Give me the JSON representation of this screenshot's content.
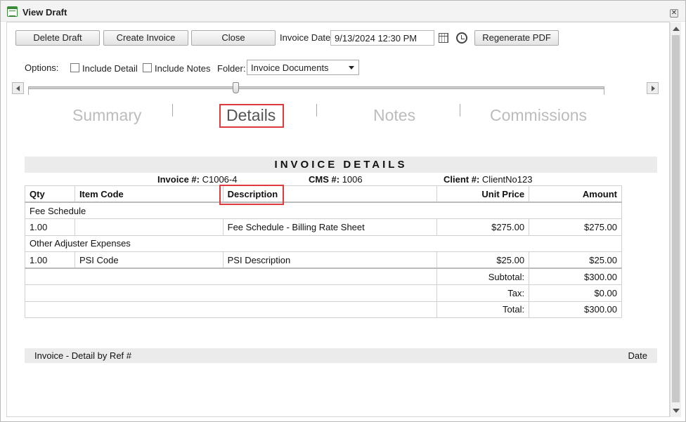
{
  "window": {
    "title": "View Draft"
  },
  "toolbar": {
    "delete_label": "Delete Draft",
    "create_label": "Create Invoice",
    "close_label": "Close",
    "invoice_date_label": "Invoice Date:",
    "invoice_date_value": "9/13/2024 12:30 PM",
    "regenerate_label": "Regenerate PDF"
  },
  "options": {
    "label": "Options:",
    "include_detail": "Include Detail",
    "include_notes": "Include Notes",
    "folder_label": "Folder:",
    "folder_value": "Invoice Documents"
  },
  "tabs": [
    "Summary",
    "Details",
    "Notes",
    "Commissions"
  ],
  "active_tab": "Details",
  "invoice": {
    "heading": "INVOICE DETAILS",
    "invoice_no_label": "Invoice #:",
    "invoice_no": "C1006-4",
    "cms_label": "CMS #:",
    "cms_no": "1006",
    "client_label": "Client #:",
    "client_no": "ClientNo123",
    "columns": {
      "qty": "Qty",
      "item_code": "Item Code",
      "description": "Description",
      "unit_price": "Unit Price",
      "amount": "Amount"
    },
    "groups": [
      {
        "name": "Fee Schedule",
        "rows": [
          {
            "qty": "1.00",
            "item_code": "",
            "description": "Fee Schedule - Billing Rate Sheet",
            "unit_price": "$275.00",
            "amount": "$275.00"
          }
        ]
      },
      {
        "name": "Other Adjuster Expenses",
        "rows": [
          {
            "qty": "1.00",
            "item_code": "PSI Code",
            "description": "PSI Description",
            "unit_price": "$25.00",
            "amount": "$25.00"
          }
        ]
      }
    ],
    "subtotal_label": "Subtotal:",
    "subtotal": "$300.00",
    "tax_label": "Tax:",
    "tax": "$0.00",
    "total_label": "Total:",
    "total": "$300.00"
  },
  "footer": {
    "left": "Invoice - Detail by Ref #",
    "right": "Date"
  },
  "colors": {
    "highlight": "#e0393e",
    "active_tab": "#555555",
    "inactive_tab": "#bcbcbc"
  }
}
